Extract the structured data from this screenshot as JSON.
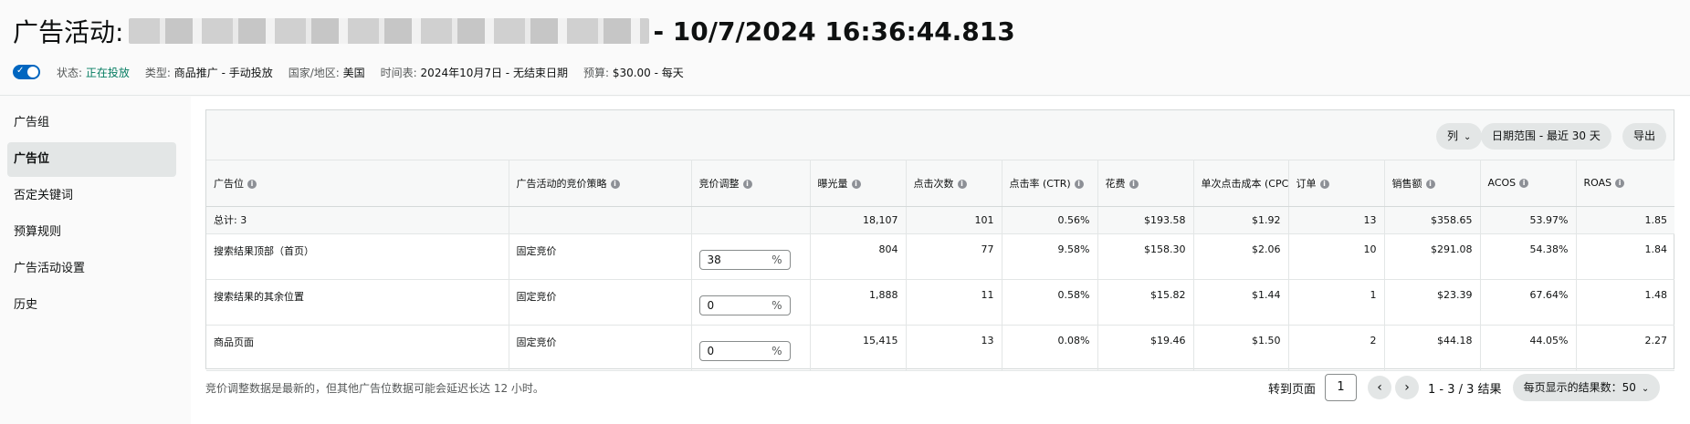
{
  "header": {
    "title_prefix": "广告活动:",
    "title_suffix": "- 10/7/2024 16:36:44.813",
    "status_label": "状态:",
    "status_value": "正在投放",
    "type_label": "类型:",
    "type_value": "商品推广 - 手动投放",
    "country_label": "国家/地区:",
    "country_value": "美国",
    "schedule_label": "时间表:",
    "schedule_value": "2024年10月7日 - 无结束日期",
    "budget_label": "预算:",
    "budget_value": "$30.00 - 每天",
    "toggle_on": true
  },
  "sidebar": {
    "items": [
      {
        "label": "广告组"
      },
      {
        "label": "广告位"
      },
      {
        "label": "否定关键词"
      },
      {
        "label": "预算规则"
      },
      {
        "label": "广告活动设置"
      },
      {
        "label": "历史"
      }
    ],
    "active_index": 1
  },
  "toolbar": {
    "columns_label": "列",
    "date_range_label": "日期范围 - 最近 30 天",
    "export_label": "导出"
  },
  "table": {
    "headers": [
      "广告位",
      "广告活动的竞价策略",
      "竞价调整",
      "曝光量",
      "点击次数",
      "点击率 (CTR)",
      "花费",
      "单次点击成本 (CPC)",
      "订单",
      "销售额",
      "ACOS",
      "ROAS"
    ],
    "total": {
      "label": "总计: 3",
      "impressions": "18,107",
      "clicks": "101",
      "ctr": "0.56%",
      "spend": "$193.58",
      "cpc": "$1.92",
      "orders": "13",
      "sales": "$358.65",
      "acos": "53.97%",
      "roas": "1.85"
    },
    "rows": [
      {
        "placement": "搜索结果顶部（首页）",
        "strategy": "固定竞价",
        "bid_adjust": "38",
        "impressions": "804",
        "clicks": "77",
        "ctr": "9.58%",
        "spend": "$158.30",
        "cpc": "$2.06",
        "orders": "10",
        "sales": "$291.08",
        "acos": "54.38%",
        "roas": "1.84"
      },
      {
        "placement": "搜索结果的其余位置",
        "strategy": "固定竞价",
        "bid_adjust": "0",
        "impressions": "1,888",
        "clicks": "11",
        "ctr": "0.58%",
        "spend": "$15.82",
        "cpc": "$1.44",
        "orders": "1",
        "sales": "$23.39",
        "acos": "67.64%",
        "roas": "1.48"
      },
      {
        "placement": "商品页面",
        "strategy": "固定竞价",
        "bid_adjust": "0",
        "impressions": "15,415",
        "clicks": "13",
        "ctr": "0.08%",
        "spend": "$19.46",
        "cpc": "$1.50",
        "orders": "2",
        "sales": "$44.18",
        "acos": "44.05%",
        "roas": "2.27"
      }
    ],
    "percent_unit": "%"
  },
  "footer": {
    "note": "竞价调整数据是最新的，但其他广告位数据可能会延迟长达 12 小时。",
    "goto_label": "转到页面",
    "page_value": "1",
    "range_text": "1 - 3 / 3 结果",
    "per_page_label": "每页显示的结果数：50"
  },
  "colors": {
    "accent": "#0066c0",
    "status_green": "#067d62",
    "active_bg": "#e3e6e6"
  }
}
